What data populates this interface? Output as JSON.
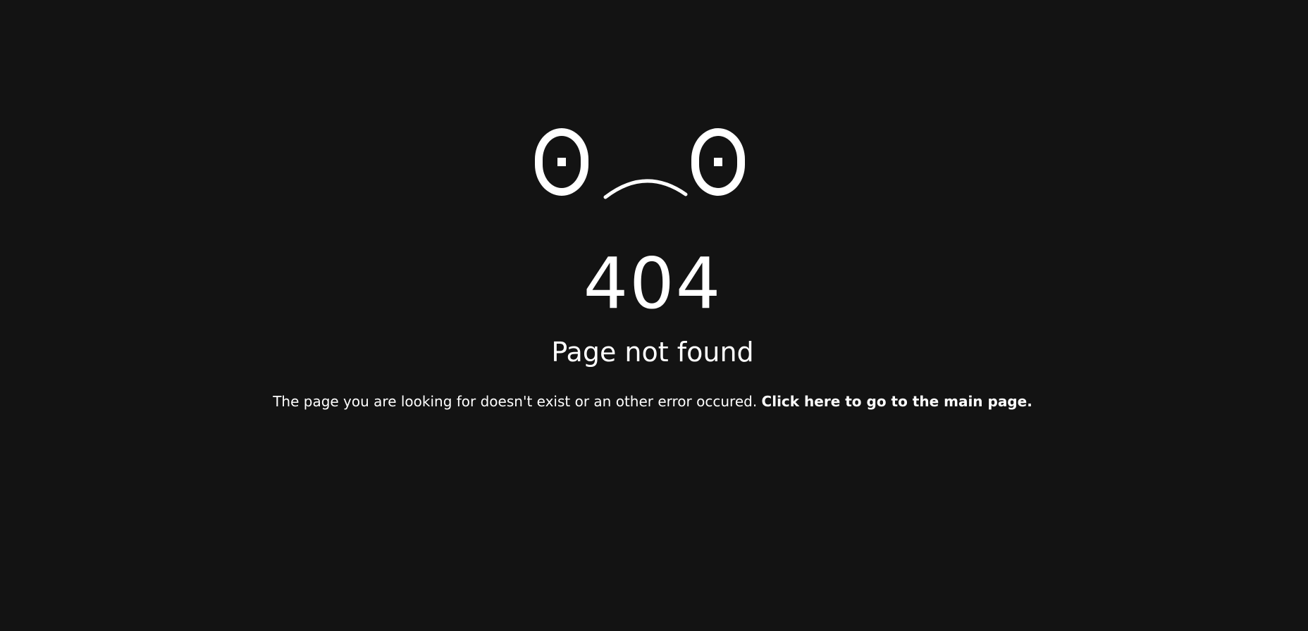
{
  "face": {
    "icon": "sad-face-icon",
    "color": "#ffffff"
  },
  "error": {
    "code": "404",
    "title": "Page not found",
    "message": "The page you are looking for doesn't exist or an other error occured.",
    "link_text": "Click here to go to the main page."
  },
  "colors": {
    "background": "#131313",
    "text": "#ffffff"
  }
}
